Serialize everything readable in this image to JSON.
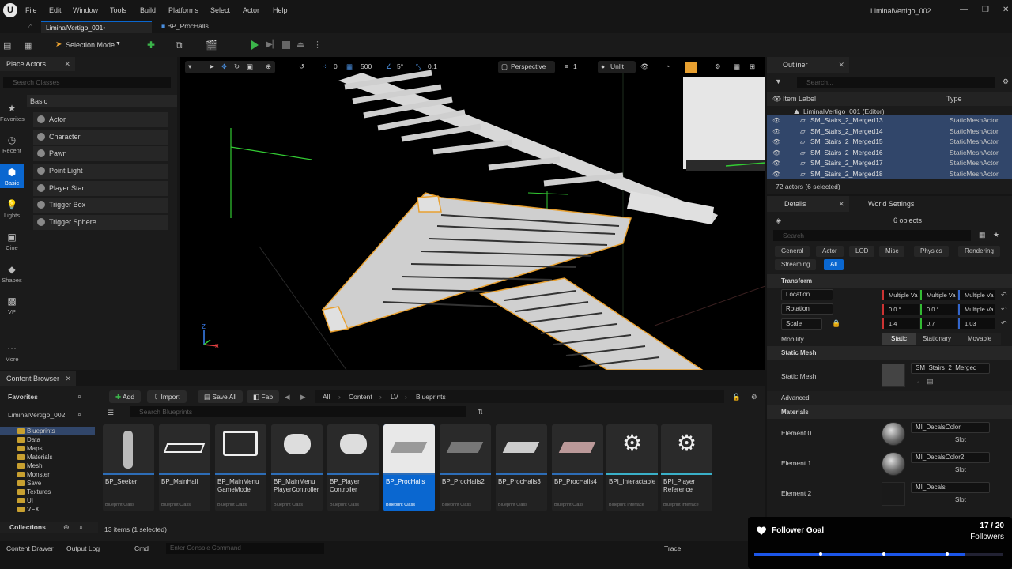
{
  "menu": [
    "File",
    "Edit",
    "Window",
    "Tools",
    "Build",
    "Platforms",
    "Select",
    "Actor",
    "Help"
  ],
  "window_title": "LiminalVertigo_002",
  "tabs": [
    "LiminalVertigo_001•",
    "BP_ProcHalls"
  ],
  "toolbar": {
    "selection_mode": "Selection Mode"
  },
  "place_actors": {
    "title": "Place Actors",
    "search_placeholder": "Search Classes",
    "section": "Basic",
    "categories": [
      "Favorites",
      "Recent",
      "Basic",
      "Lights",
      "Cine",
      "Shapes",
      "VP",
      "More"
    ],
    "actors": [
      "Actor",
      "Character",
      "Pawn",
      "Point Light",
      "Player Start",
      "Trigger Box",
      "Trigger Sphere"
    ]
  },
  "viewport": {
    "grid": "0",
    "grid_size": "500",
    "rotation_snap": "5°",
    "scale_snap": "0.1",
    "view": "Perspective",
    "camera_speed": "1",
    "view_mode": "Unlit"
  },
  "outliner": {
    "title": "Outliner",
    "search_placeholder": "Search...",
    "col_label": "Item Label",
    "col_type": "Type",
    "root": "LiminalVertigo_001 (Editor)",
    "rows": [
      {
        "label": "SM_Stairs_2_Merged13",
        "type": "StaticMeshActor"
      },
      {
        "label": "SM_Stairs_2_Merged14",
        "type": "StaticMeshActor"
      },
      {
        "label": "SM_Stairs_2_Merged15",
        "type": "StaticMeshActor"
      },
      {
        "label": "SM_Stairs_2_Merged16",
        "type": "StaticMeshActor"
      },
      {
        "label": "SM_Stairs_2_Merged17",
        "type": "StaticMeshActor"
      },
      {
        "label": "SM_Stairs_2_Merged18",
        "type": "StaticMeshActor"
      }
    ],
    "count": "72 actors (6 selected)"
  },
  "details": {
    "tab": "Details",
    "world_tab": "World Settings",
    "objects": "6 objects",
    "search_placeholder": "Search",
    "filters": [
      "General",
      "Actor",
      "LOD",
      "Misc",
      "Physics",
      "Rendering",
      "Streaming",
      "All"
    ],
    "transform": "Transform",
    "location_label": "Location",
    "location": [
      "Multiple Va",
      "Multiple Va",
      "Multiple Va"
    ],
    "rotation_label": "Rotation",
    "rotation": [
      "0.0 °",
      "0.0 °",
      "Multiple Va"
    ],
    "scale_label": "Scale",
    "scale": [
      "1.4",
      "0.7",
      "1.03"
    ],
    "mobility_label": "Mobility",
    "mobility": [
      "Static",
      "Stationary",
      "Movable"
    ],
    "static_mesh_section": "Static Mesh",
    "static_mesh_label": "Static Mesh",
    "static_mesh_value": "SM_Stairs_2_Merged",
    "advanced": "Advanced",
    "materials_section": "Materials",
    "slot": "Slot",
    "elements": [
      {
        "label": "Element 0",
        "material": "MI_DecalsColor"
      },
      {
        "label": "Element 1",
        "material": "MI_DecalsColor2"
      },
      {
        "label": "Element 2",
        "material": "MI_Decals"
      }
    ]
  },
  "content_browser": {
    "title": "Content Browser",
    "add": "Add",
    "import": "Import",
    "save_all": "Save All",
    "fab": "Fab",
    "breadcrumb": [
      "All",
      "Content",
      "LV",
      "Blueprints"
    ],
    "favorites": "Favorites",
    "project": "LiminalVertigo_002",
    "search_placeholder": "Search Blueprints",
    "folders": [
      "Blueprints",
      "Data",
      "Maps",
      "Materials",
      "Mesh",
      "Monster",
      "Save",
      "Textures",
      "UI",
      "VFX"
    ],
    "assets": [
      {
        "name": "BP_Seeker",
        "type": "Blueprint Class"
      },
      {
        "name": "BP_MainHall",
        "type": "Blueprint Class"
      },
      {
        "name": "BP_MainMenu GameMode",
        "type": "Blueprint Class"
      },
      {
        "name": "BP_MainMenu PlayerController",
        "type": "Blueprint Class"
      },
      {
        "name": "BP_Player Controller",
        "type": "Blueprint Class"
      },
      {
        "name": "BP_ProcHalls",
        "type": "Blueprint Class"
      },
      {
        "name": "BP_ProcHalls2",
        "type": "Blueprint Class"
      },
      {
        "name": "BP_ProcHalls3",
        "type": "Blueprint Class"
      },
      {
        "name": "BP_ProcHalls4",
        "type": "Blueprint Class"
      },
      {
        "name": "BPI_Interactable",
        "type": "Blueprint Interface"
      },
      {
        "name": "BPI_Player Reference",
        "type": "Blueprint Interface"
      }
    ],
    "item_count": "13 items (1 selected)",
    "collections": "Collections"
  },
  "status": {
    "content_drawer": "Content Drawer",
    "output_log": "Output Log",
    "cmd": "Cmd",
    "console_placeholder": "Enter Console Command",
    "trace": "Trace"
  },
  "follower_goal": {
    "title": "Follower Goal",
    "count": "17 / 20",
    "unit": "Followers",
    "progress": 0.85,
    "color": "#1c56e8"
  }
}
